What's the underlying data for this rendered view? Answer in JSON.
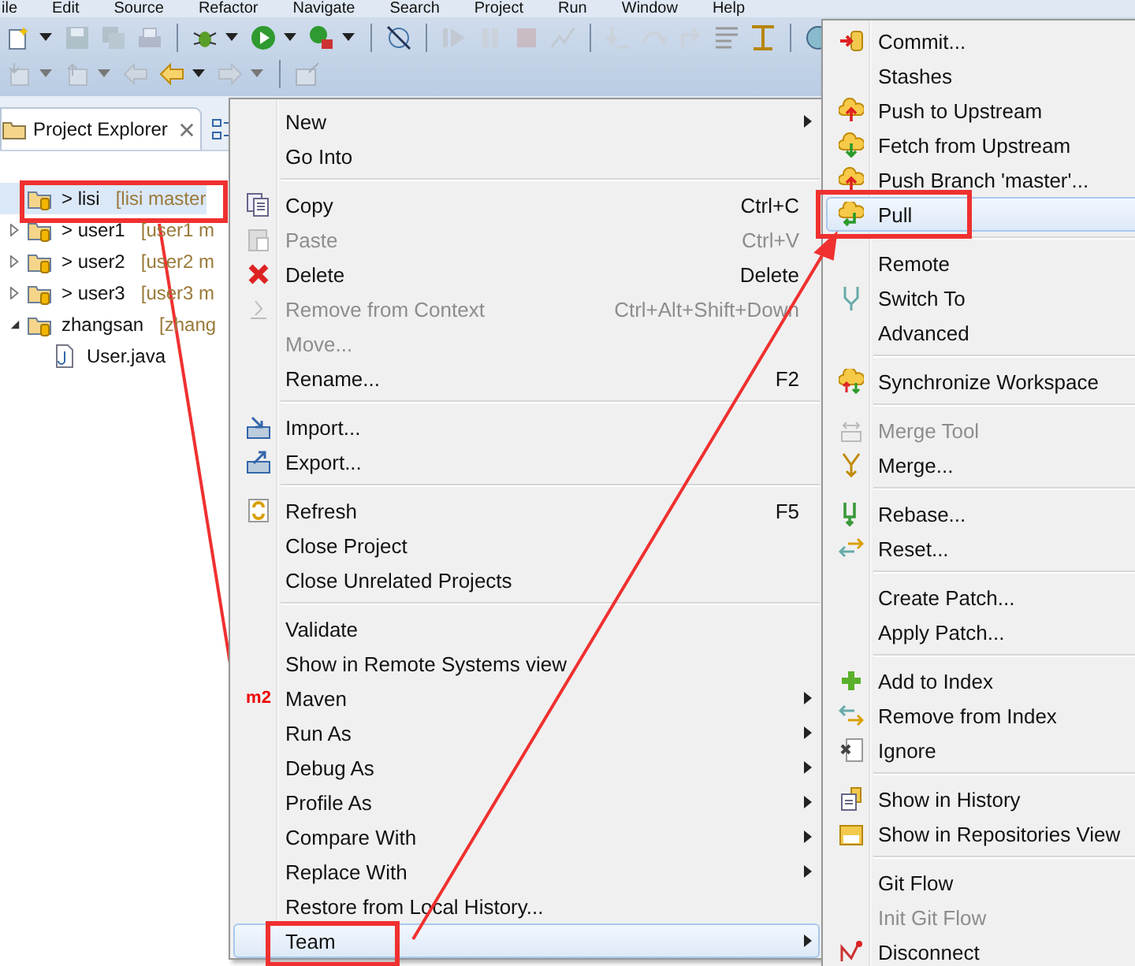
{
  "menubar": [
    "ile",
    "Edit",
    "Source",
    "Refactor",
    "Navigate",
    "Search",
    "Project",
    "Run",
    "Window",
    "Help"
  ],
  "explorer": {
    "tab_label": "Project Explorer",
    "tree": [
      {
        "name": "> lisi",
        "decoration": "[lisi master",
        "selected": true
      },
      {
        "name": "> user1",
        "decoration": "[user1 m",
        "expanded": false,
        "selected": false
      },
      {
        "name": "> user2",
        "decoration": "[user2 m",
        "expanded": false,
        "selected": false
      },
      {
        "name": "> user3",
        "decoration": "[user3 m",
        "expanded": false,
        "selected": false
      },
      {
        "name": "zhangsan",
        "decoration": "[zhang",
        "expanded": true,
        "selected": false,
        "children": [
          {
            "name": "User.java",
            "selected": false
          }
        ]
      }
    ]
  },
  "context_menu": {
    "groups": [
      [
        {
          "label": "New",
          "submenu": true,
          "disabled": false,
          "selected": false
        },
        {
          "label": "Go Into",
          "submenu": false,
          "disabled": false,
          "selected": false
        }
      ],
      [
        {
          "label": "Copy",
          "shortcut": "Ctrl+C",
          "submenu": false,
          "disabled": false,
          "selected": false
        },
        {
          "label": "Paste",
          "shortcut": "Ctrl+V",
          "submenu": false,
          "disabled": true,
          "selected": false
        },
        {
          "label": "Delete",
          "shortcut": "Delete",
          "submenu": false,
          "disabled": false,
          "selected": false
        },
        {
          "label": "Remove from Context",
          "shortcut": "Ctrl+Alt+Shift+Down",
          "submenu": false,
          "disabled": true,
          "selected": false
        },
        {
          "label": "Move...",
          "submenu": false,
          "disabled": true,
          "selected": false
        },
        {
          "label": "Rename...",
          "shortcut": "F2",
          "submenu": false,
          "disabled": false,
          "selected": false
        }
      ],
      [
        {
          "label": "Import...",
          "submenu": false,
          "disabled": false,
          "selected": false
        },
        {
          "label": "Export...",
          "submenu": false,
          "disabled": false,
          "selected": false
        }
      ],
      [
        {
          "label": "Refresh",
          "shortcut": "F5",
          "submenu": false,
          "disabled": false,
          "selected": false
        },
        {
          "label": "Close Project",
          "submenu": false,
          "disabled": false,
          "selected": false
        },
        {
          "label": "Close Unrelated Projects",
          "submenu": false,
          "disabled": false,
          "selected": false
        }
      ],
      [
        {
          "label": "Validate",
          "submenu": false,
          "disabled": false,
          "selected": false
        },
        {
          "label": "Show in Remote Systems view",
          "submenu": false,
          "disabled": false,
          "selected": false
        },
        {
          "label": "Maven",
          "icon_text": "m2",
          "submenu": true,
          "disabled": false,
          "selected": false
        },
        {
          "label": "Run As",
          "submenu": true,
          "disabled": false,
          "selected": false
        },
        {
          "label": "Debug As",
          "submenu": true,
          "disabled": false,
          "selected": false
        },
        {
          "label": "Profile As",
          "submenu": true,
          "disabled": false,
          "selected": false
        },
        {
          "label": "Compare With",
          "submenu": true,
          "disabled": false,
          "selected": false
        },
        {
          "label": "Replace With",
          "submenu": true,
          "disabled": false,
          "selected": false
        },
        {
          "label": "Restore from Local History...",
          "submenu": false,
          "disabled": false,
          "selected": false
        },
        {
          "label": "Team",
          "submenu": true,
          "disabled": false,
          "selected": true
        }
      ]
    ]
  },
  "team_menu": {
    "groups": [
      [
        {
          "label": "Commit...",
          "disabled": false,
          "selected": false
        },
        {
          "label": "Stashes",
          "disabled": false,
          "selected": false
        },
        {
          "label": "Push to Upstream",
          "disabled": false,
          "selected": false
        },
        {
          "label": "Fetch from Upstream",
          "disabled": false,
          "selected": false
        },
        {
          "label": "Push Branch 'master'...",
          "disabled": false,
          "selected": false
        },
        {
          "label": "Pull",
          "disabled": false,
          "selected": true
        }
      ],
      [
        {
          "label": "Remote",
          "disabled": false,
          "selected": false
        },
        {
          "label": "Switch To",
          "disabled": false,
          "selected": false
        },
        {
          "label": "Advanced",
          "disabled": false,
          "selected": false
        }
      ],
      [
        {
          "label": "Synchronize Workspace",
          "disabled": false,
          "selected": false
        }
      ],
      [
        {
          "label": "Merge Tool",
          "disabled": true,
          "selected": false
        },
        {
          "label": "Merge...",
          "disabled": false,
          "selected": false
        }
      ],
      [
        {
          "label": "Rebase...",
          "disabled": false,
          "selected": false
        },
        {
          "label": "Reset...",
          "disabled": false,
          "selected": false
        }
      ],
      [
        {
          "label": "Create Patch...",
          "disabled": false,
          "selected": false
        },
        {
          "label": "Apply Patch...",
          "disabled": false,
          "selected": false
        }
      ],
      [
        {
          "label": "Add to Index",
          "disabled": false,
          "selected": false
        },
        {
          "label": "Remove from Index",
          "disabled": false,
          "selected": false
        },
        {
          "label": "Ignore",
          "disabled": false,
          "selected": false
        }
      ],
      [
        {
          "label": "Show in History",
          "disabled": false,
          "selected": false
        },
        {
          "label": "Show in Repositories View",
          "disabled": false,
          "selected": false
        }
      ],
      [
        {
          "label": "Git Flow",
          "disabled": false,
          "selected": false
        },
        {
          "label": "Init Git Flow",
          "disabled": true,
          "selected": false
        },
        {
          "label": "Disconnect",
          "disabled": false,
          "selected": false
        }
      ]
    ]
  }
}
